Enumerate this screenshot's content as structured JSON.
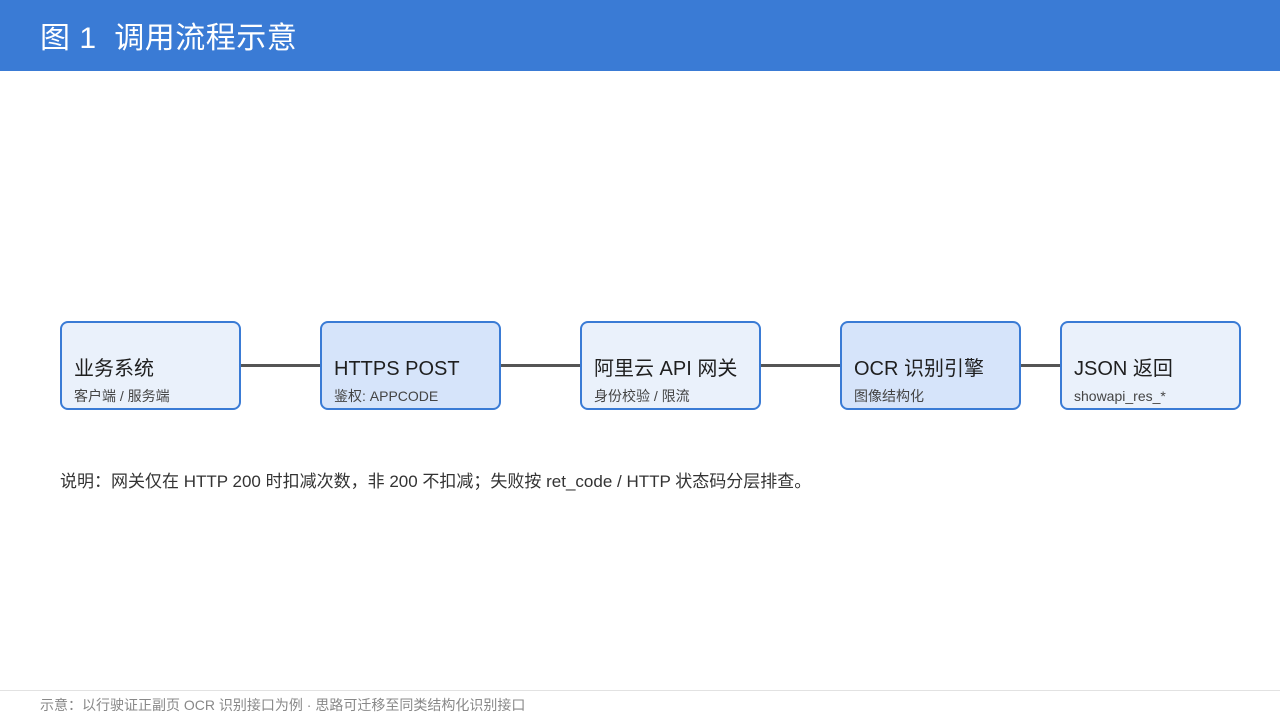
{
  "header": {
    "title": "图 1  调用流程示意"
  },
  "flow": {
    "nodes": [
      {
        "title": "业务系统",
        "subtitle": "客户端 / 服务端"
      },
      {
        "title": "HTTPS POST",
        "subtitle": "鉴权: APPCODE"
      },
      {
        "title": "阿里云 API 网关",
        "subtitle": "身份校验 / 限流"
      },
      {
        "title": "OCR 识别引擎",
        "subtitle": "图像结构化"
      },
      {
        "title": "JSON 返回",
        "subtitle": "showapi_res_*"
      }
    ]
  },
  "note": {
    "text": "说明：网关仅在 HTTP 200 时扣减次数，非 200 不扣减；失败按 ret_code / HTTP 状态码分层排查。"
  },
  "footer": {
    "text": "示意：以行驶证正副页 OCR 识别接口为例 · 思路可迁移至同类结构化识别接口"
  },
  "colors": {
    "header_bg": "#3a7bd5",
    "node_border": "#3a7bd5",
    "node_fill_light": "#eaf1fb",
    "node_fill_alt": "#d6e4fa",
    "connector": "#555555"
  }
}
